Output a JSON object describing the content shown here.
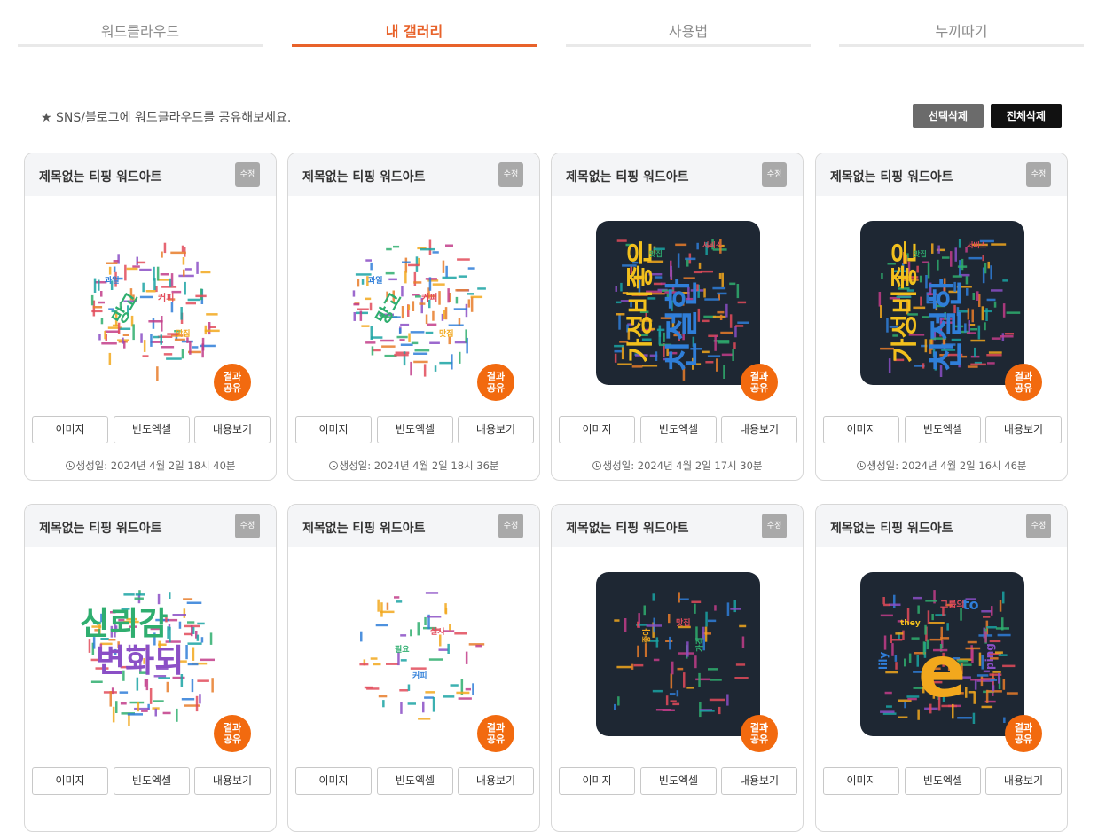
{
  "tabs": [
    {
      "label": "워드클라우드",
      "active": false
    },
    {
      "label": "내 갤러리",
      "active": true
    },
    {
      "label": "사용법",
      "active": false
    },
    {
      "label": "누끼따기",
      "active": false
    }
  ],
  "notice": "★ SNS/블로그에 워드클라우드를 공유해보세요.",
  "toolbar": {
    "delete_selected": "선택삭제",
    "delete_all": "전체삭제"
  },
  "card_labels": {
    "edit": "수정",
    "share": "결과\n공유",
    "image": "이미지",
    "freq_excel": "빈도엑셀",
    "view_content": "내용보기"
  },
  "cards": [
    {
      "title": "제목없는 티핑 워드아트",
      "date": "생성일: 2024년 4월 2일 18시 40분",
      "thumb": "white-cloud",
      "words": [
        "망고",
        "커피",
        "과일",
        "맛집"
      ]
    },
    {
      "title": "제목없는 티핑 워드아트",
      "date": "생성일: 2024년 4월 2일 18시 36분",
      "thumb": "white-cloud",
      "words": [
        "망고",
        "커피",
        "과일",
        "맛집"
      ]
    },
    {
      "title": "제목없는 티핑 워드아트",
      "date": "생성일: 2024년 4월 2일 17시 30분",
      "thumb": "dark-head",
      "words": [
        "가성비좋은",
        "친절한",
        "서비스",
        "맛집"
      ]
    },
    {
      "title": "제목없는 티핑 워드아트",
      "date": "생성일: 2024년 4월 2일 16시 46분",
      "thumb": "dark-head",
      "words": [
        "가성비좋은",
        "친절한",
        "서비스",
        "맛집"
      ]
    },
    {
      "title": "제목없는 티핑 워드아트",
      "date": "",
      "thumb": "white-big",
      "words": [
        "신뢰감",
        "변화되"
      ]
    },
    {
      "title": "제목없는 티핑 워드아트",
      "date": "",
      "thumb": "white-sparse",
      "words": [
        "필요",
        "실시",
        "커피"
      ]
    },
    {
      "title": "제목없는 티핑 워드아트",
      "date": "",
      "thumb": "dark-sparse",
      "words": [
        "좋아",
        "가격",
        "맛집"
      ]
    },
    {
      "title": "제목없는 티핑 워드아트",
      "date": "",
      "thumb": "dark-english",
      "words": [
        "e",
        "to",
        "lily",
        "ping",
        "they",
        "그룹의"
      ]
    }
  ],
  "colors": {
    "accent": "#e8622a",
    "share": "#f26a0f",
    "dark_thumb": "#1e2733"
  }
}
